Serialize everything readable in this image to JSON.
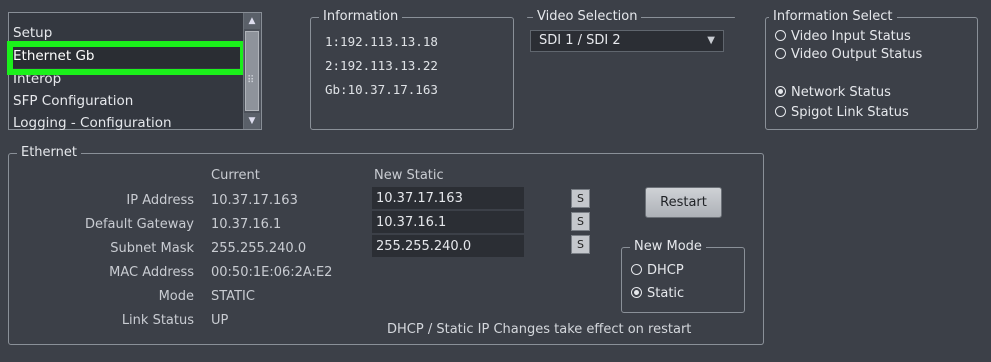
{
  "nav_list": {
    "items": [
      "Setup",
      "Ethernet Gb",
      "Interop",
      "SFP Configuration",
      "Logging - Configuration"
    ],
    "selected_index": 1
  },
  "information": {
    "title": "Information",
    "lines": [
      "1:192.113.13.18",
      "2:192.113.13.22",
      "Gb:10.37.17.163"
    ]
  },
  "video_selection": {
    "title": "Video Selection",
    "selected": "SDI 1 / SDI 2"
  },
  "information_select": {
    "title": "Information Select",
    "options": [
      {
        "label": "Video Input Status",
        "checked": false
      },
      {
        "label": "Video Output Status",
        "checked": false
      },
      {
        "label": "Network Status",
        "checked": true
      },
      {
        "label": "Spigot Link Status",
        "checked": false
      }
    ]
  },
  "ethernet": {
    "title": "Ethernet",
    "current_header": "Current",
    "new_static_header": "New Static",
    "rows": [
      {
        "label": "IP Address",
        "current": "10.37.17.163",
        "new": "10.37.17.163"
      },
      {
        "label": "Default Gateway",
        "current": "10.37.16.1",
        "new": "10.37.16.1"
      },
      {
        "label": "Subnet Mask",
        "current": "255.255.240.0",
        "new": "255.255.240.0"
      },
      {
        "label": "MAC Address",
        "current": "00:50:1E:06:2A:E2"
      },
      {
        "label": "Mode",
        "current": "STATIC"
      },
      {
        "label": "Link Status",
        "current": "UP"
      }
    ],
    "set_label": "S",
    "restart_label": "Restart",
    "new_mode": {
      "title": "New Mode",
      "options": [
        {
          "label": "DHCP",
          "checked": false
        },
        {
          "label": "Static",
          "checked": true
        }
      ]
    },
    "note": "DHCP / Static IP Changes take effect on restart"
  },
  "colors": {
    "background": "#3c4048",
    "highlight": "#1bf01b"
  }
}
